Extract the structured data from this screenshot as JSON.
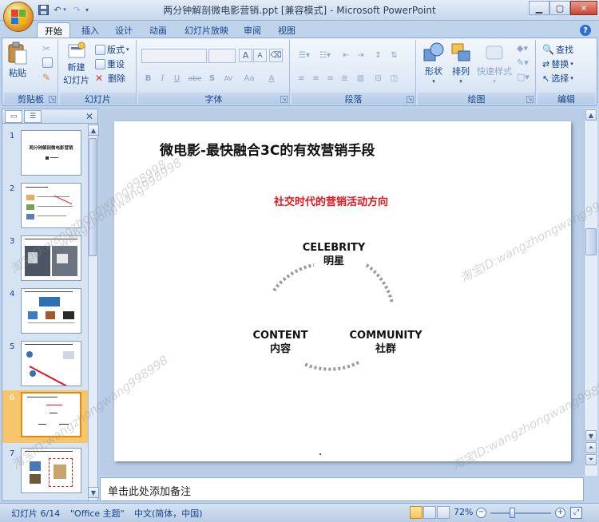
{
  "window": {
    "title": "两分钟解剖微电影营销.ppt [兼容模式] - Microsoft PowerPoint"
  },
  "ribbon_tabs": [
    "开始",
    "插入",
    "设计",
    "动画",
    "幻灯片放映",
    "审阅",
    "视图"
  ],
  "ribbon": {
    "clipboard": {
      "label": "剪贴板",
      "paste": "粘贴"
    },
    "slides": {
      "label": "幻灯片",
      "new_slide_1": "新建",
      "new_slide_2": "幻灯片",
      "layout": "版式",
      "reset": "重设",
      "delete": "删除"
    },
    "font": {
      "label": "字体",
      "bold": "B",
      "italic": "I",
      "underline": "U",
      "strike": "abe",
      "shadow": "S",
      "grow": "A",
      "shrink": "A",
      "spacing": "AV",
      "case": "Aa",
      "color": "A"
    },
    "paragraph": {
      "label": "段落"
    },
    "drawing": {
      "label": "绘图",
      "shapes": "形状",
      "arrange": "排列",
      "quick_styles": "快速样式"
    },
    "editing": {
      "label": "编辑",
      "find": "查找",
      "replace": "替换",
      "select": "选择"
    }
  },
  "slides_pane": {
    "thumb_numbers": [
      "1",
      "2",
      "3",
      "4",
      "5",
      "6",
      "7"
    ],
    "selected_index": 6,
    "thumb1_title": "两分钟解剖微电影营销"
  },
  "slide": {
    "title": "微电影-最快融合3C的有效营销手段",
    "subtitle": "社交时代的营销活动方向",
    "nodes": {
      "celebrity_en": "CELEBRITY",
      "celebrity_cn": "明星",
      "content_en": "CONTENT",
      "content_cn": "内容",
      "community_en": "COMMUNITY",
      "community_cn": "社群"
    },
    "accent_color": "#e8141b"
  },
  "notes": {
    "placeholder": "单击此处添加备注"
  },
  "status": {
    "slide_pos": "幻灯片 6/14",
    "theme": "\"Office 主题\"",
    "language": "中文(简体，中国)",
    "zoom": "72%",
    "zoom_level": 0.72
  },
  "watermark": {
    "text_1": "淘宝ID:wangzhongwang998998",
    "text_2": "wangzhongwang998998",
    "text_3": "淘宝ID:wangzhongwang998998",
    "text_4": "淘宝ID:wangzhongwang998998",
    "text_5": "淘宝ID:wangzhongwang998998"
  }
}
